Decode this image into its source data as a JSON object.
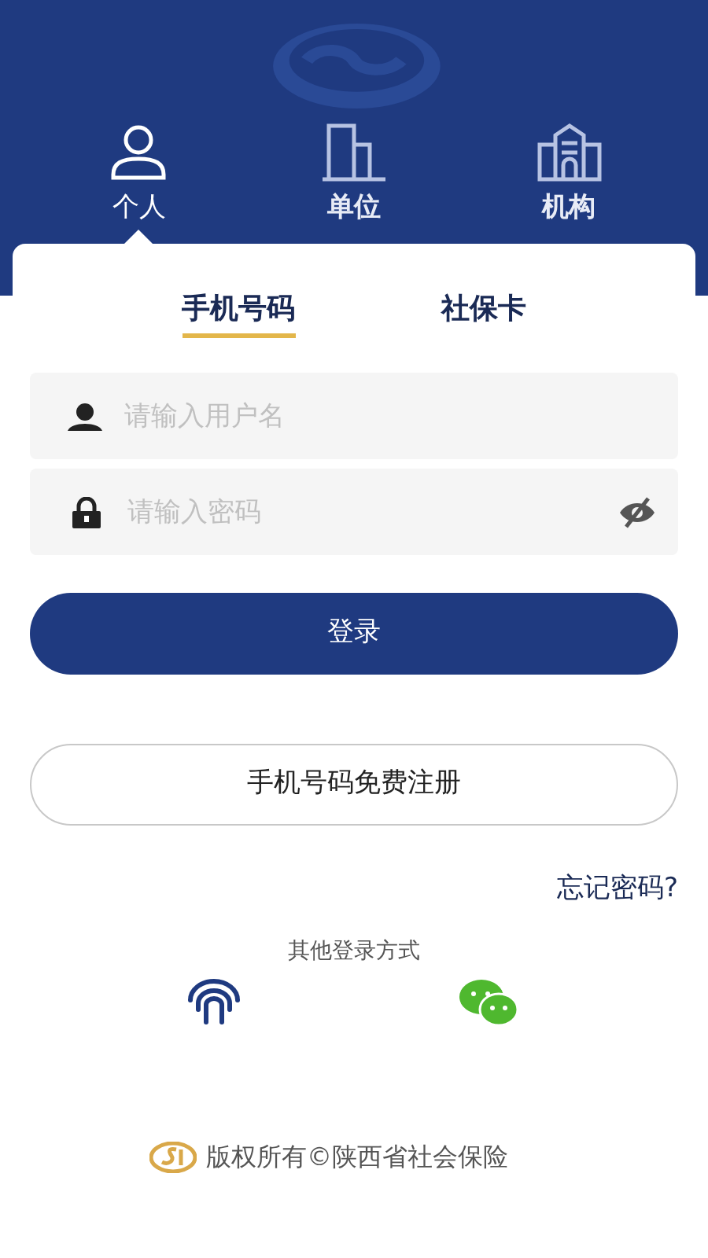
{
  "role_tabs": [
    {
      "label": "个人",
      "kind": "person",
      "selected": true
    },
    {
      "label": "单位",
      "kind": "building",
      "selected": false
    },
    {
      "label": "机构",
      "kind": "institution",
      "selected": false
    }
  ],
  "login_tabs": [
    {
      "label": "手机号码",
      "selected": true
    },
    {
      "label": "社保卡",
      "selected": false
    }
  ],
  "username_field": {
    "placeholder": "请输入用户名"
  },
  "password_field": {
    "placeholder": "请输入密码"
  },
  "login_button": "登录",
  "register_button": "手机号码免费注册",
  "forgot_password": "忘记密码?",
  "other_login": {
    "title": "其他登录方式",
    "methods": [
      {
        "kind": "fingerprint"
      },
      {
        "kind": "wechat"
      }
    ]
  },
  "footer": "版权所有©陕西省社会保险"
}
